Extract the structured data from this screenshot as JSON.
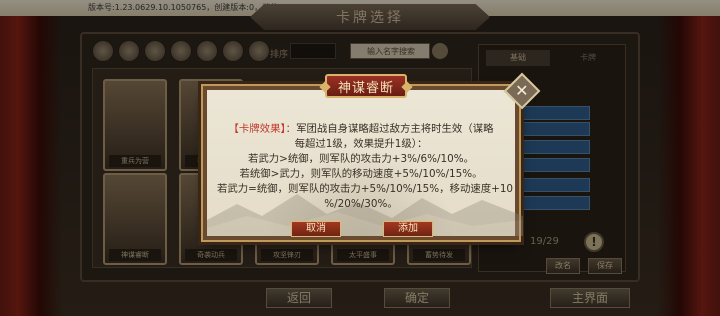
{
  "topbar": {
    "version_text": "版本号:1.23.0629.10.1050765，创建版本:0，档位:0"
  },
  "screen": {
    "title": "卡牌选择"
  },
  "filters": {
    "sort_label": "排序",
    "search_placeholder": "输入名字搜索",
    "icons": [
      "filter-all-icon",
      "filter-hero-icon",
      "filter-troop-icon",
      "filter-strategy-icon",
      "filter-sword-icon",
      "filter-cavalry-icon",
      "filter-book-icon"
    ]
  },
  "cards": [
    {
      "label": "重兵为营"
    },
    {
      "label": "神谋睿断"
    },
    {
      "label": "奇袭动兵"
    },
    {
      "label": "攻坚锋刃"
    },
    {
      "label": "太平盛事"
    },
    {
      "label": "蓄势待发"
    }
  ],
  "right_panel": {
    "tabs": [
      "基础",
      "卡牌"
    ],
    "counter": "19/29",
    "warning": "!",
    "buttons": [
      "改名",
      "保存"
    ]
  },
  "bottom_buttons": {
    "back": "返回",
    "confirm": "确定",
    "home": "主界面"
  },
  "modal": {
    "title": "神谋睿断",
    "close": "✕",
    "effect_tag": "【卡牌效果】：",
    "line1": "军团战自身谋略超过敌方主将时生效（谋略",
    "line2": "每超过1级，效果提升1级）：",
    "line3": "若武力>统御，则军队的攻击力+3%/6%/10%。",
    "line4": "若统御>武力，则军队的移动速度+5%/10%/15%。",
    "line5": "若武力=统御，则军队的攻击力+5%/10%/15%，移动速度+10",
    "line6": "%/20%/30%。",
    "cancel": "取消",
    "add": "添加"
  },
  "colors": {
    "modal_bg": "#ece6d6",
    "accent_red": "#c0392b",
    "frame_brown": "#6a4a2e"
  }
}
